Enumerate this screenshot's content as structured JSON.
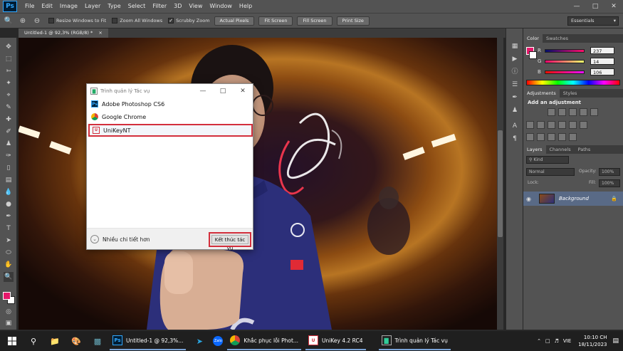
{
  "app": {
    "logo": "Ps",
    "menu": [
      "File",
      "Edit",
      "Image",
      "Layer",
      "Type",
      "Select",
      "Filter",
      "3D",
      "View",
      "Window",
      "Help"
    ]
  },
  "options": {
    "resize_windows": "Resize Windows to Fit",
    "zoom_all": "Zoom All Windows",
    "scrubby_zoom": "Scrubby Zoom",
    "scrubby_checked": true,
    "actual_pixels": "Actual Pixels",
    "fit_screen": "Fit Screen",
    "fill_screen": "Fill Screen",
    "print_size": "Print Size",
    "workspace": "Essentials"
  },
  "document": {
    "tab_title": "Untitled-1 @ 92,3% (RGB/8) *",
    "close": "×"
  },
  "colors": {
    "foreground": "#e5186b",
    "background": "#ffffff",
    "accent_red": "#d32f3c"
  },
  "panels": {
    "color_tab": "Color",
    "swatches_tab": "Swatches",
    "r_label": "R",
    "g_label": "G",
    "b_label": "B",
    "r_value": "237",
    "g_value": "14",
    "b_value": "106",
    "adjustments_tab": "Adjustments",
    "styles_tab": "Styles",
    "add_adjustment": "Add an adjustment",
    "layers_tab": "Layers",
    "channels_tab": "Channels",
    "paths_tab": "Paths",
    "kind_filter": "Kind",
    "blend_mode": "Normal",
    "opacity_label": "Opacity:",
    "opacity_value": "100%",
    "lock_label": "Lock:",
    "fill_label": "Fill:",
    "fill_value": "100%",
    "layer_name": "Background"
  },
  "task_manager": {
    "title": "Trình quản lý Tác vụ",
    "apps": [
      {
        "name": "Adobe Photoshop CS6",
        "icon": "photoshop-icon"
      },
      {
        "name": "Google Chrome",
        "icon": "chrome-icon"
      },
      {
        "name": "UniKeyNT",
        "icon": "unikey-icon"
      }
    ],
    "more_details": "Nhiều chi tiết hơn",
    "end_task": "Kết thúc tác vụ"
  },
  "taskbar": {
    "apps": [
      {
        "label": "Untitled-1 @ 92,3%...",
        "icon": "photoshop-icon"
      },
      {
        "label": "Khắc phục lỗi Phot...",
        "icon": "chrome-icon"
      },
      {
        "label": "UniKey 4.2 RC4",
        "icon": "unikey-icon"
      },
      {
        "label": "Trình quản lý Tác vụ",
        "icon": "task-manager-icon"
      }
    ],
    "language": "VIE",
    "time": "10:10 CH",
    "date": "18/11/2023"
  }
}
